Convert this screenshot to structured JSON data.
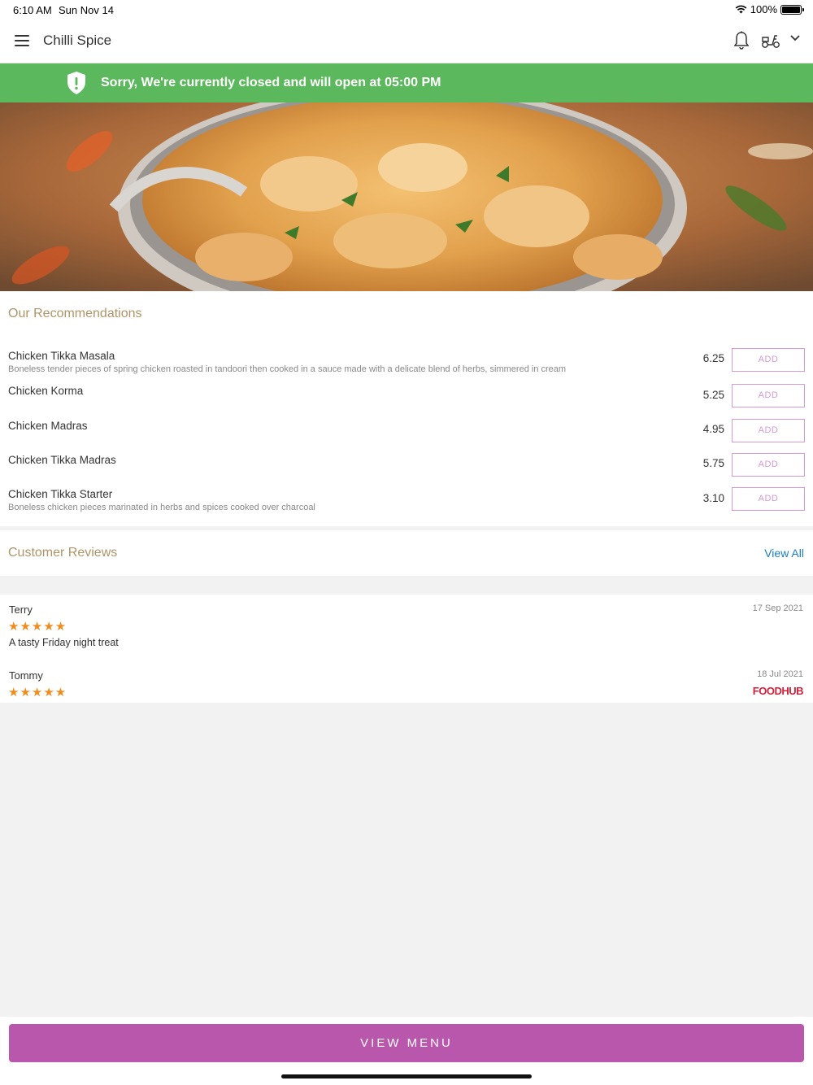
{
  "status": {
    "time": "6:10 AM",
    "date": "Sun Nov 14",
    "battery": "100%"
  },
  "header": {
    "title": "Chilli Spice"
  },
  "banner": {
    "message": "Sorry, We're currently closed and will open at 05:00 PM",
    "color": "#5cb85c"
  },
  "recommendations": {
    "title": "Our Recommendations",
    "items": [
      {
        "name": "Chicken Tikka Masala",
        "desc": "Boneless tender pieces of spring chicken roasted in tandoori then cooked in a sauce made with a delicate blend of herbs, simmered in cream",
        "price": "6.25",
        "add": "ADD"
      },
      {
        "name": "Chicken Korma",
        "desc": "",
        "price": "5.25",
        "add": "ADD"
      },
      {
        "name": "Chicken Madras",
        "desc": "",
        "price": "4.95",
        "add": "ADD"
      },
      {
        "name": "Chicken Tikka Madras",
        "desc": "",
        "price": "5.75",
        "add": "ADD"
      },
      {
        "name": "Chicken Tikka Starter",
        "desc": "Boneless chicken pieces marinated in herbs and spices cooked over charcoal",
        "price": "3.10",
        "add": "ADD"
      }
    ]
  },
  "reviews": {
    "title": "Customer Reviews",
    "view_all": "View All",
    "items": [
      {
        "author": "Terry",
        "date": "17 Sep 2021",
        "stars": "★★★★★",
        "rating": 5,
        "text": "A tasty Friday night treat"
      },
      {
        "author": "Tommy",
        "date": "18 Jul 2021",
        "stars": "★★★★★",
        "rating": 5,
        "brand": "FOODHUB"
      }
    ]
  },
  "footer": {
    "view_menu": "VIEW MENU",
    "color": "#b957ac"
  }
}
